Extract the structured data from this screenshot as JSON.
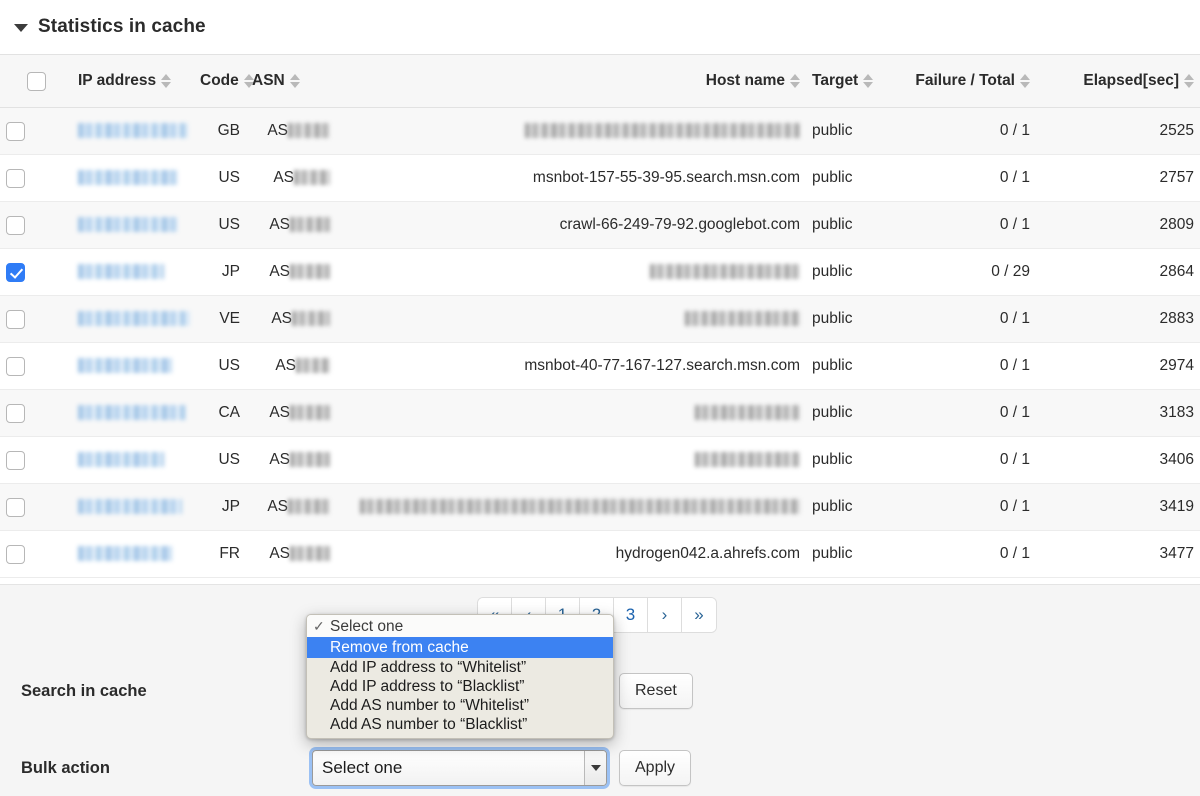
{
  "panel": {
    "title": "Statistics in cache",
    "disclosure_icon": "triangle-down-icon"
  },
  "table": {
    "columns": [
      {
        "key": "checkbox",
        "label": "",
        "sortable": false
      },
      {
        "key": "ip",
        "label": "IP address",
        "sortable": true
      },
      {
        "key": "code",
        "label": "Code",
        "sortable": true
      },
      {
        "key": "asn",
        "label": "ASN",
        "sortable": true
      },
      {
        "key": "host",
        "label": "Host name",
        "sortable": true
      },
      {
        "key": "target",
        "label": "Target",
        "sortable": true
      },
      {
        "key": "failure",
        "label": "Failure / Total",
        "sortable": true
      },
      {
        "key": "elapsed",
        "label": "Elapsed[sec]",
        "sortable": true
      }
    ],
    "select_all_checked": false,
    "rows": [
      {
        "checked": false,
        "ip": "",
        "ip_redacted": true,
        "ip_width": 110,
        "code": "GB",
        "asn": "AS",
        "asn_redacted": true,
        "asn_width": 42,
        "host": "",
        "host_redacted": true,
        "host_width": 275,
        "target": "public",
        "failure": "0 / 1",
        "elapsed": "2525"
      },
      {
        "checked": false,
        "ip": "",
        "ip_redacted": true,
        "ip_width": 100,
        "code": "US",
        "asn": "AS",
        "asn_redacted": true,
        "asn_width": 36,
        "host": "msnbot-157-55-39-95.search.msn.com",
        "host_redacted": false,
        "host_width": 0,
        "target": "public",
        "failure": "0 / 1",
        "elapsed": "2757"
      },
      {
        "checked": false,
        "ip": "",
        "ip_redacted": true,
        "ip_width": 100,
        "code": "US",
        "asn": "AS",
        "asn_redacted": true,
        "asn_width": 40,
        "host": "crawl-66-249-79-92.googlebot.com",
        "host_redacted": false,
        "host_width": 0,
        "target": "public",
        "failure": "0 / 1",
        "elapsed": "2809"
      },
      {
        "checked": true,
        "ip": "",
        "ip_redacted": true,
        "ip_width": 86,
        "code": "JP",
        "asn": "AS",
        "asn_redacted": true,
        "asn_width": 40,
        "host": "",
        "host_redacted": true,
        "host_width": 150,
        "target": "public",
        "failure": "0 / 29",
        "elapsed": "2864"
      },
      {
        "checked": false,
        "ip": "",
        "ip_redacted": true,
        "ip_width": 112,
        "code": "VE",
        "asn": "AS",
        "asn_redacted": true,
        "asn_width": 38,
        "host": "",
        "host_redacted": true,
        "host_width": 115,
        "target": "public",
        "failure": "0 / 1",
        "elapsed": "2883"
      },
      {
        "checked": false,
        "ip": "",
        "ip_redacted": true,
        "ip_width": 94,
        "code": "US",
        "asn": "AS",
        "asn_redacted": true,
        "asn_width": 34,
        "host": "msnbot-40-77-167-127.search.msn.com",
        "host_redacted": false,
        "host_width": 0,
        "target": "public",
        "failure": "0 / 1",
        "elapsed": "2974"
      },
      {
        "checked": false,
        "ip": "",
        "ip_redacted": true,
        "ip_width": 108,
        "code": "CA",
        "asn": "AS",
        "asn_redacted": true,
        "asn_width": 40,
        "host": "",
        "host_redacted": true,
        "host_width": 105,
        "target": "public",
        "failure": "0 / 1",
        "elapsed": "3183"
      },
      {
        "checked": false,
        "ip": "",
        "ip_redacted": true,
        "ip_width": 86,
        "code": "US",
        "asn": "AS",
        "asn_redacted": true,
        "asn_width": 40,
        "host": "",
        "host_redacted": true,
        "host_width": 105,
        "target": "public",
        "failure": "0 / 1",
        "elapsed": "3406"
      },
      {
        "checked": false,
        "ip": "",
        "ip_redacted": true,
        "ip_width": 104,
        "code": "JP",
        "asn": "AS",
        "asn_redacted": true,
        "asn_width": 42,
        "host": "",
        "host_redacted": true,
        "host_width": 440,
        "target": "public",
        "failure": "0 / 1",
        "elapsed": "3419"
      },
      {
        "checked": false,
        "ip": "",
        "ip_redacted": true,
        "ip_width": 94,
        "code": "FR",
        "asn": "AS",
        "asn_redacted": true,
        "asn_width": 40,
        "host": "hydrogen042.a.ahrefs.com",
        "host_redacted": false,
        "host_width": 0,
        "target": "public",
        "failure": "0 / 1",
        "elapsed": "3477"
      }
    ]
  },
  "pagination": {
    "items": [
      {
        "label": "«",
        "name": "first",
        "current": false
      },
      {
        "label": "‹",
        "name": "prev",
        "current": false
      },
      {
        "label": "1",
        "name": "page-1",
        "current": false
      },
      {
        "label": "2",
        "name": "page-2",
        "current": false
      },
      {
        "label": "3",
        "name": "page-3",
        "current": true
      },
      {
        "label": "›",
        "name": "next",
        "current": false
      },
      {
        "label": "»",
        "name": "last",
        "current": false
      }
    ],
    "current_page": "3"
  },
  "forms": {
    "search_label": "Search in cache",
    "search_value": "",
    "search_placeholder": "",
    "reset_label": "Reset",
    "bulk_label": "Bulk action",
    "bulk_selected": "Select one",
    "apply_label": "Apply",
    "select_arrow_icon": "chevron-down-icon"
  },
  "dropdown": {
    "open": true,
    "check_icon": "check-icon",
    "items": [
      {
        "label": "Select one",
        "checked": true,
        "highlighted": false,
        "placeholder": true
      },
      {
        "label": "Remove from cache",
        "checked": false,
        "highlighted": true,
        "placeholder": false
      },
      {
        "label": "Add IP address to “Whitelist”",
        "checked": false,
        "highlighted": false,
        "placeholder": false
      },
      {
        "label": "Add IP address to “Blacklist”",
        "checked": false,
        "highlighted": false,
        "placeholder": false
      },
      {
        "label": "Add AS number to “Whitelist”",
        "checked": false,
        "highlighted": false,
        "placeholder": false
      },
      {
        "label": "Add AS number to “Blacklist”",
        "checked": false,
        "highlighted": false,
        "placeholder": false
      }
    ]
  },
  "colors": {
    "accent_blue": "#2f7cf6",
    "menu_highlight": "#3c82f2",
    "menu_bg": "#eceae2",
    "link_blue": "#2a6496",
    "row_stripe": "#f8f8f8",
    "header_bg": "#f7f7f7",
    "panel_bg": "#f5f5f5"
  }
}
